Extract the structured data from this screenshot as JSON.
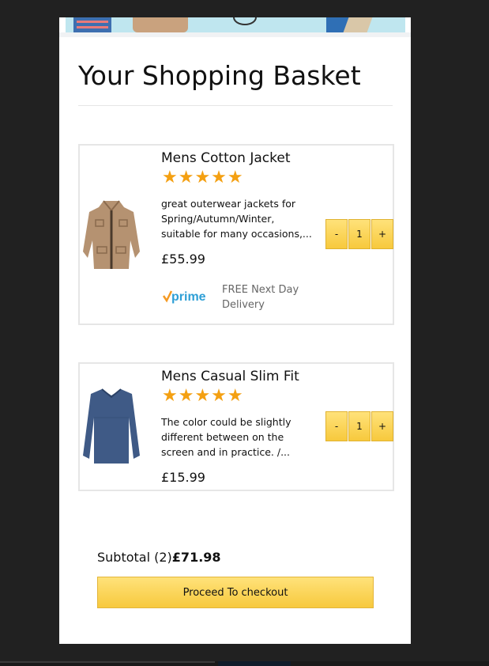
{
  "page": {
    "title": "Your Shopping Basket"
  },
  "basket": {
    "items": [
      {
        "name": "Mens Cotton Jacket",
        "rating": 5,
        "stars": "★★★★★",
        "desc_lines": [
          "great outerwear jackets for",
          "Spring/Autumn/Winter,",
          "suitable for many occasions,..."
        ],
        "price": "£55.99",
        "image_icon": "jacket-image",
        "prime": true,
        "prime_label": "prime",
        "delivery_lines": [
          "FREE Next Day",
          "Delivery"
        ],
        "quantity": "1"
      },
      {
        "name": "Mens Casual Slim Fit",
        "rating": 5,
        "stars": "★★★★★",
        "desc_lines": [
          "The color could be slightly",
          "different between on the",
          "screen and in practice. /..."
        ],
        "price": "£15.99",
        "image_icon": "tshirt-image",
        "prime": false,
        "quantity": "1"
      }
    ],
    "qty_minus": "-",
    "qty_plus": "+"
  },
  "summary": {
    "subtotal_label": "Subtotal (2)",
    "subtotal_amount": "£71.98",
    "checkout_label": "Proceed To checkout"
  },
  "colors": {
    "accent_button": "#f7c93d",
    "star": "#f4a012",
    "prime_blue": "#2e9fd6",
    "prime_check": "#f59a23"
  }
}
